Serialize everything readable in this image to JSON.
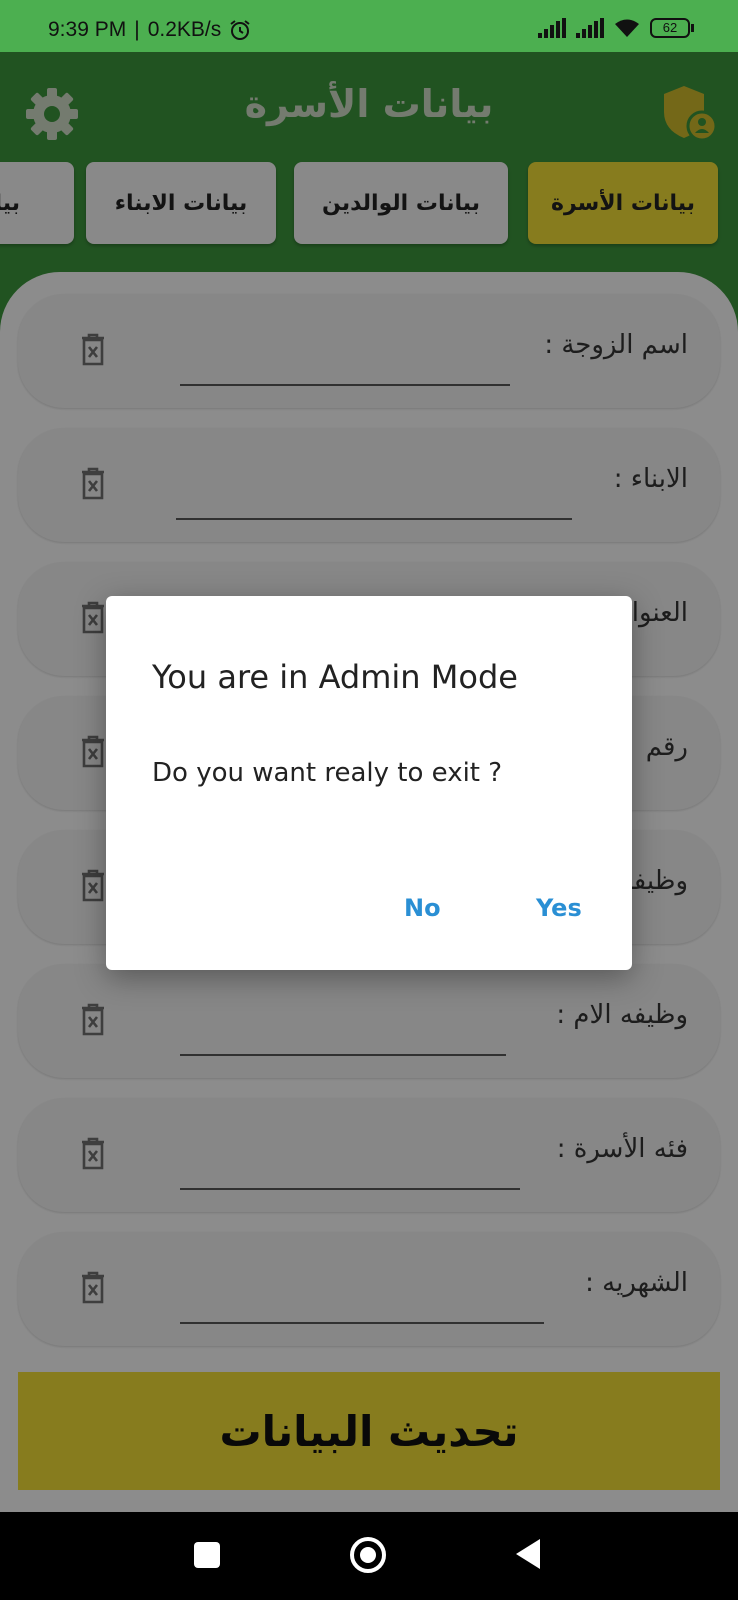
{
  "status_bar": {
    "time": "9:39 PM",
    "speed": "0.2KB/s",
    "battery": "62"
  },
  "header": {
    "title": "بيانات الأسرة"
  },
  "tabs": [
    {
      "label": "بيانات الأسرة",
      "active": true
    },
    {
      "label": "بيانات الوالدين",
      "active": false
    },
    {
      "label": "بيانات الابناء",
      "active": false
    },
    {
      "label": "بيانا",
      "active": false
    }
  ],
  "fields": [
    {
      "label": "اسم الزوجة :"
    },
    {
      "label": "الابناء :"
    },
    {
      "label": "العنوان"
    },
    {
      "label": "رقم"
    },
    {
      "label": "وظيفة"
    },
    {
      "label": "وظيفه الام :"
    },
    {
      "label": "فئه الأسرة :"
    },
    {
      "label": "الشهريه :"
    }
  ],
  "update_button": {
    "label": "تحديث البيانات"
  },
  "dialog": {
    "title": "You are in Admin Mode",
    "message": "Do you want realy to exit ?",
    "no_label": "No",
    "yes_label": "Yes"
  },
  "colors": {
    "header_green": "#3a8f3a",
    "status_green": "#4caf50",
    "accent_yellow": "#e8d635",
    "dialog_button_blue": "#2a8fd4"
  },
  "icons": {
    "settings": "gear-icon",
    "admin": "shield-user-icon",
    "delete": "trash-icon"
  }
}
